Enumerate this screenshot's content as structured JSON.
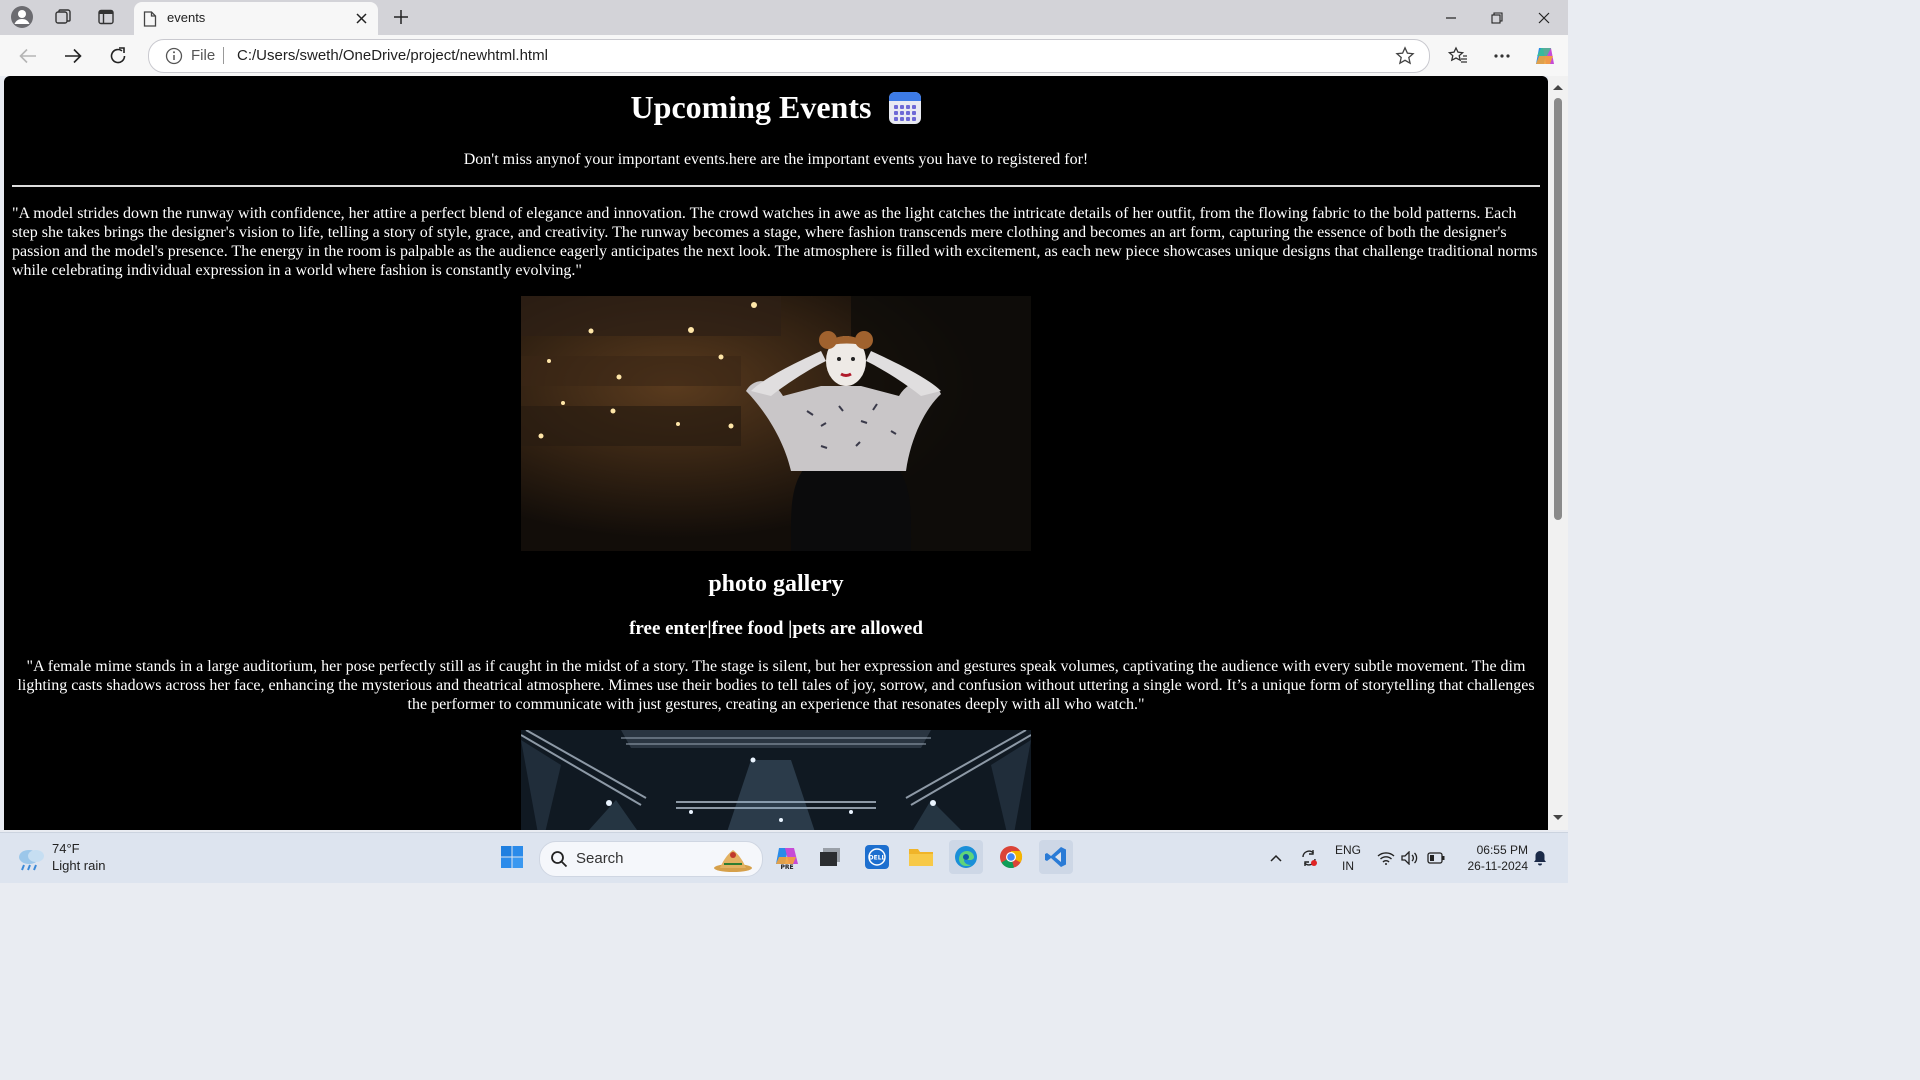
{
  "browser": {
    "tab_title": "events",
    "omnibox_label": "File",
    "url": "C:/Users/sweth/OneDrive/project/newhtml.html"
  },
  "page": {
    "heading": "Upcoming Events",
    "heading_icon": "calendar-icon",
    "tagline": "Don't miss anynof your important events.here are the important events you have to registered for!",
    "paragraph1": "\"A model strides down the runway with confidence, her attire a perfect blend of elegance and innovation. The crowd watches in awe as the light catches the intricate details of her outfit, from the flowing fabric to the bold patterns. Each step she takes brings the designer's vision to life, telling a story of style, grace, and creativity. The runway becomes a stage, where fashion transcends mere clothing and becomes an art form, capturing the essence of both the designer's passion and the model's presence. The energy in the room is palpable as the audience eagerly anticipates the next look. The atmosphere is filled with excitement, as each new piece showcases unique designs that challenge traditional norms while celebrating individual expression in a world where fashion is constantly evolving.\"",
    "gallery_title": "photo gallery",
    "gallery_subtitle": "free enter|free food |pets are allowed",
    "paragraph2": "\"A female mime stands in a large auditorium, her pose perfectly still as if caught in the midst of a story. The stage is silent, but her expression and gestures speak volumes, captivating the audience with every subtle movement. The dim lighting casts shadows across her face, enhancing the mysterious and theatrical atmosphere. Mimes use their bodies to tell tales of joy, sorrow, and confusion without uttering a single word. It’s a unique form of storytelling that challenges the performer to communicate with just gestures, creating an experience that resonates deeply with all who watch.\""
  },
  "taskbar": {
    "weather_temp": "74°F",
    "weather_cond": "Light rain",
    "search_label": "Search",
    "lang_line1": "ENG",
    "lang_line2": "IN",
    "time": "06:55 PM",
    "date": "26-11-2024"
  },
  "colors": {
    "page_background": "#000000",
    "page_text": "#ffffff",
    "vscode_blue": "#2a7bd6",
    "edge_accent": "#1a8fd8"
  }
}
